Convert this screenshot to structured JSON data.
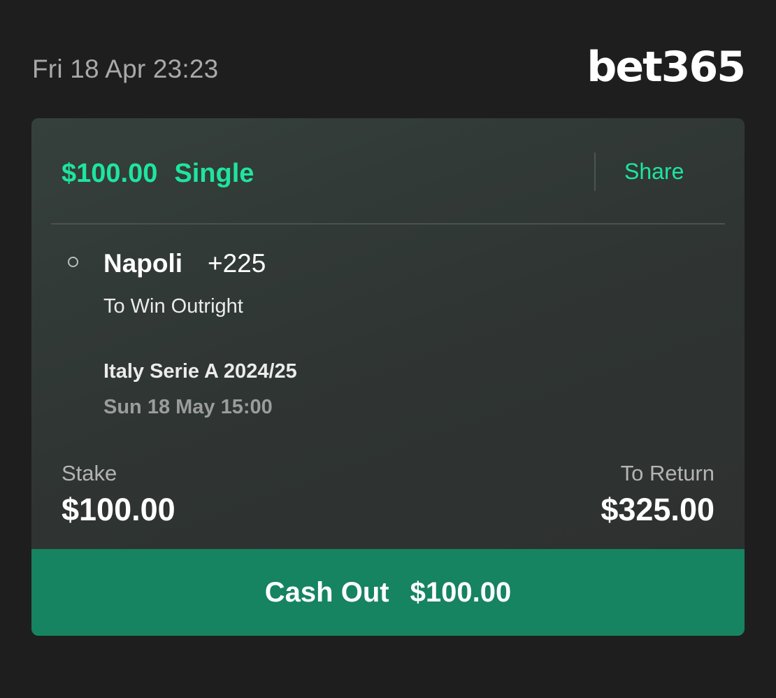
{
  "topbar": {
    "datetime": "Fri 18 Apr 23:23",
    "logo": "bet365"
  },
  "bet": {
    "stake_amount": "$100.00",
    "bet_type": "Single",
    "share_label": "Share",
    "selection": {
      "name": "Napoli",
      "odds": "+225",
      "market": "To Win Outright",
      "competition": "Italy Serie A 2024/25",
      "event_date": "Sun 18 May 15:00"
    },
    "stake_label": "Stake",
    "stake_value": "$100.00",
    "return_label": "To Return",
    "return_value": "$325.00",
    "cashout": {
      "label": "Cash Out",
      "amount": "$100.00"
    }
  },
  "colors": {
    "accent": "#1ee59f",
    "cashout_bg": "#168361",
    "page_bg": "#1e1e1e"
  }
}
